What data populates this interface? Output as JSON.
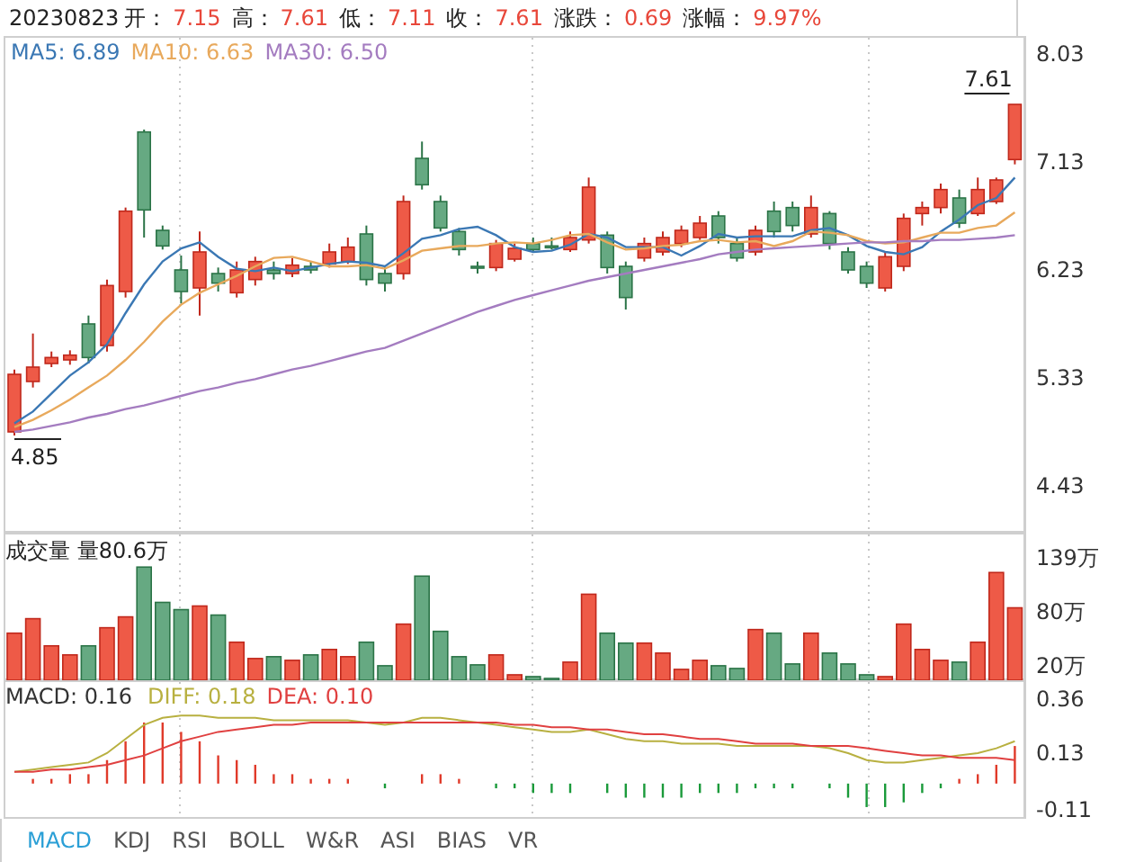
{
  "header": {
    "date": "20230823",
    "fields": [
      {
        "label": "开：",
        "value": "7.15"
      },
      {
        "label": "高：",
        "value": "7.61"
      },
      {
        "label": "低：",
        "value": "7.11"
      },
      {
        "label": "收：",
        "value": "7.61"
      },
      {
        "label": "涨跌：",
        "value": "0.69"
      },
      {
        "label": "涨幅：",
        "value": "9.97%"
      }
    ]
  },
  "price_panel": {
    "candles": {
      "chart_data": {
        "type": "candlestick",
        "categories": [
          null,
          null,
          null,
          null,
          null,
          null,
          null,
          null,
          null,
          null,
          null,
          null,
          null,
          null,
          null,
          null,
          null,
          null,
          null,
          null,
          null,
          null,
          null,
          null,
          null,
          null,
          null,
          null,
          null,
          null,
          null,
          null,
          null,
          null,
          null,
          null,
          null,
          null,
          null,
          null,
          null,
          null,
          null,
          null,
          null,
          null,
          null,
          null,
          null,
          null,
          null,
          null,
          null,
          null,
          null
        ],
        "ylim": [
          4.04,
          8.18
        ],
        "annotations": [
          {
            "text": "7.61"
          },
          {
            "text": "4.85"
          }
        ],
        "ohlc": [
          [
            4.88,
            5.4,
            4.85,
            5.36
          ],
          [
            5.3,
            5.7,
            5.25,
            5.42
          ],
          [
            5.45,
            5.55,
            5.42,
            5.5
          ],
          [
            5.48,
            5.56,
            5.44,
            5.52
          ],
          [
            5.78,
            5.85,
            5.45,
            5.5
          ],
          [
            5.6,
            6.15,
            5.55,
            6.1
          ],
          [
            6.05,
            6.75,
            6.0,
            6.72
          ],
          [
            7.38,
            7.4,
            6.5,
            6.73
          ],
          [
            6.56,
            6.6,
            6.4,
            6.43
          ],
          [
            6.23,
            6.35,
            5.95,
            6.05
          ],
          [
            6.08,
            6.55,
            5.85,
            6.38
          ],
          [
            6.2,
            6.25,
            6.05,
            6.12
          ],
          [
            6.04,
            6.3,
            6.0,
            6.23
          ],
          [
            6.15,
            6.34,
            6.1,
            6.3
          ],
          [
            6.23,
            6.3,
            6.15,
            6.2
          ],
          [
            6.2,
            6.33,
            6.17,
            6.27
          ],
          [
            6.26,
            6.3,
            6.2,
            6.23
          ],
          [
            6.28,
            6.45,
            6.25,
            6.38
          ],
          [
            6.3,
            6.5,
            6.28,
            6.42
          ],
          [
            6.53,
            6.6,
            6.1,
            6.15
          ],
          [
            6.2,
            6.25,
            6.05,
            6.12
          ],
          [
            6.2,
            6.85,
            6.15,
            6.8
          ],
          [
            7.16,
            7.3,
            6.9,
            6.94
          ],
          [
            6.8,
            6.85,
            6.55,
            6.58
          ],
          [
            6.55,
            6.58,
            6.35,
            6.4
          ],
          [
            6.26,
            6.3,
            6.2,
            6.25
          ],
          [
            6.25,
            6.48,
            6.22,
            6.45
          ],
          [
            6.32,
            6.45,
            6.3,
            6.41
          ],
          [
            6.45,
            6.5,
            6.38,
            6.4
          ],
          [
            6.43,
            6.5,
            6.4,
            6.42
          ],
          [
            6.4,
            6.55,
            6.38,
            6.5
          ],
          [
            6.48,
            7.0,
            6.45,
            6.92
          ],
          [
            6.52,
            6.55,
            6.2,
            6.25
          ],
          [
            6.26,
            6.3,
            5.9,
            6.0
          ],
          [
            6.33,
            6.5,
            6.3,
            6.45
          ],
          [
            6.38,
            6.55,
            6.35,
            6.5
          ],
          [
            6.45,
            6.6,
            6.42,
            6.56
          ],
          [
            6.5,
            6.68,
            6.48,
            6.62
          ],
          [
            6.68,
            6.72,
            6.45,
            6.5
          ],
          [
            6.45,
            6.5,
            6.3,
            6.33
          ],
          [
            6.38,
            6.6,
            6.35,
            6.56
          ],
          [
            6.72,
            6.8,
            6.5,
            6.55
          ],
          [
            6.75,
            6.8,
            6.55,
            6.6
          ],
          [
            6.53,
            6.85,
            6.5,
            6.75
          ],
          [
            6.7,
            6.72,
            6.4,
            6.45
          ],
          [
            6.38,
            6.42,
            6.2,
            6.23
          ],
          [
            6.26,
            6.3,
            6.08,
            6.12
          ],
          [
            6.08,
            6.38,
            6.05,
            6.34
          ],
          [
            6.26,
            6.7,
            6.22,
            6.66
          ],
          [
            6.7,
            6.8,
            6.6,
            6.75
          ],
          [
            6.75,
            6.95,
            6.7,
            6.9
          ],
          [
            6.83,
            6.9,
            6.58,
            6.62
          ],
          [
            6.7,
            7.0,
            6.68,
            6.9
          ],
          [
            6.8,
            7.0,
            6.78,
            6.98
          ],
          [
            7.15,
            7.61,
            7.11,
            7.61
          ]
        ]
      }
    },
    "chart_data": {
      "type": "line",
      "grid": "x",
      "categories": [
        null,
        null,
        null,
        null,
        null,
        null,
        null,
        null,
        null,
        null,
        null,
        null,
        null,
        null,
        null,
        null,
        null,
        null,
        null,
        null,
        null,
        null,
        null,
        null,
        null,
        null,
        null,
        null,
        null,
        null,
        null,
        null,
        null,
        null,
        null,
        null,
        null,
        null,
        null,
        null,
        null,
        null,
        null,
        null,
        null,
        null,
        null,
        null,
        null,
        null,
        null,
        null,
        null,
        null,
        null
      ],
      "yticks": [
        {
          "value": 8.03,
          "label": "8.03"
        },
        {
          "value": 7.13,
          "label": "7.13"
        },
        {
          "value": 6.23,
          "label": "6.23"
        },
        {
          "value": 5.33,
          "label": "5.33"
        },
        {
          "value": 4.43,
          "label": "4.43"
        }
      ],
      "ylim": [
        4.04,
        8.18
      ],
      "series": [
        {
          "name": "MA5: 6.89",
          "color": "#3b78b4",
          "values": [
            4.95,
            5.05,
            5.2,
            5.35,
            5.46,
            5.61,
            5.87,
            6.11,
            6.3,
            6.41,
            6.46,
            6.34,
            6.24,
            6.22,
            6.25,
            6.22,
            6.25,
            6.28,
            6.3,
            6.29,
            6.26,
            6.37,
            6.49,
            6.52,
            6.57,
            6.59,
            6.52,
            6.42,
            6.38,
            6.39,
            6.44,
            6.53,
            6.5,
            6.42,
            6.42,
            6.42,
            6.35,
            6.43,
            6.53,
            6.5,
            6.51,
            6.51,
            6.51,
            6.56,
            6.58,
            6.52,
            6.43,
            6.38,
            6.36,
            6.42,
            6.55,
            6.65,
            6.77,
            6.83,
            7.0
          ]
        },
        {
          "name": "MA10: 6.63",
          "color": "#e8a95c",
          "values": [
            4.92,
            4.98,
            5.06,
            5.15,
            5.25,
            5.35,
            5.48,
            5.63,
            5.8,
            5.94,
            6.04,
            6.11,
            6.18,
            6.26,
            6.33,
            6.34,
            6.3,
            6.26,
            6.26,
            6.27,
            6.24,
            6.31,
            6.39,
            6.41,
            6.43,
            6.43,
            6.45,
            6.46,
            6.45,
            6.48,
            6.52,
            6.53,
            6.46,
            6.4,
            6.41,
            6.43,
            6.44,
            6.47,
            6.48,
            6.46,
            6.47,
            6.43,
            6.47,
            6.55,
            6.54,
            6.52,
            6.47,
            6.45,
            6.46,
            6.5,
            6.54,
            6.54,
            6.58,
            6.6,
            6.71
          ]
        },
        {
          "name": "MA30: 6.50",
          "color": "#a47cc0",
          "values": [
            4.88,
            4.9,
            4.93,
            4.96,
            5.0,
            5.03,
            5.07,
            5.1,
            5.14,
            5.18,
            5.22,
            5.25,
            5.29,
            5.32,
            5.36,
            5.4,
            5.43,
            5.47,
            5.51,
            5.55,
            5.58,
            5.64,
            5.7,
            5.76,
            5.82,
            5.88,
            5.93,
            5.98,
            6.02,
            6.06,
            6.1,
            6.14,
            6.17,
            6.2,
            6.23,
            6.26,
            6.29,
            6.32,
            6.36,
            6.38,
            6.4,
            6.41,
            6.42,
            6.43,
            6.44,
            6.45,
            6.46,
            6.46,
            6.47,
            6.47,
            6.48,
            6.48,
            6.49,
            6.5,
            6.52
          ]
        }
      ]
    }
  },
  "volume_panel": {
    "title": "成交量 量80.6万",
    "chart_data": {
      "type": "bar",
      "grid": "x",
      "categories": [
        null,
        null,
        null,
        null,
        null,
        null,
        null,
        null,
        null,
        null,
        null,
        null,
        null,
        null,
        null,
        null,
        null,
        null,
        null,
        null,
        null,
        null,
        null,
        null,
        null,
        null,
        null,
        null,
        null,
        null,
        null,
        null,
        null,
        null,
        null,
        null,
        null,
        null,
        null,
        null,
        null,
        null,
        null,
        null,
        null,
        null,
        null,
        null,
        null,
        null,
        null,
        null,
        null,
        null,
        null
      ],
      "ylim": [
        4,
        167
      ],
      "yticks": [
        {
          "value": 139,
          "label": "139万"
        },
        {
          "value": 80,
          "label": "80万"
        },
        {
          "value": 20,
          "label": "20万"
        }
      ],
      "values": [
        56,
        72,
        42,
        32,
        42,
        62,
        74,
        129,
        90,
        82,
        86,
        76,
        46,
        28,
        30,
        26,
        32,
        38,
        30,
        46,
        20,
        66,
        119,
        58,
        30,
        21,
        32,
        10,
        8,
        6,
        24,
        99,
        56,
        45,
        45,
        34,
        16,
        26,
        20,
        17,
        60,
        56,
        22,
        56,
        34,
        22,
        10,
        8,
        66,
        38,
        26,
        24,
        46,
        123,
        84
      ]
    }
  },
  "macd_panel": {
    "histogram": {
      "chart_data": {
        "type": "bar",
        "title": "MACD: 0.16",
        "categories": [
          null,
          null,
          null,
          null,
          null,
          null,
          null,
          null,
          null,
          null,
          null,
          null,
          null,
          null,
          null,
          null,
          null,
          null,
          null,
          null,
          null,
          null,
          null,
          null,
          null,
          null,
          null,
          null,
          null,
          null,
          null,
          null,
          null,
          null,
          null,
          null,
          null,
          null,
          null,
          null,
          null,
          null,
          null,
          null,
          null,
          null,
          null,
          null,
          null,
          null,
          null,
          null,
          null,
          null,
          null
        ],
        "ylim": [
          -0.15,
          0.44
        ],
        "values": [
          0,
          0.02,
          0.02,
          0.04,
          0.04,
          0.1,
          0.18,
          0.26,
          0.26,
          0.22,
          0.18,
          0.12,
          0.1,
          0.08,
          0.04,
          0.04,
          0.02,
          0.02,
          0.02,
          0,
          -0.02,
          0,
          0.04,
          0.04,
          0.02,
          0,
          -0.02,
          -0.02,
          -0.04,
          -0.04,
          -0.04,
          0,
          -0.04,
          -0.06,
          -0.06,
          -0.06,
          -0.06,
          -0.04,
          -0.04,
          -0.04,
          -0.02,
          -0.02,
          -0.02,
          0,
          -0.02,
          -0.06,
          -0.1,
          -0.1,
          -0.08,
          -0.04,
          -0.02,
          0.02,
          0.04,
          0.08,
          0.16
        ]
      }
    },
    "chart_data": {
      "type": "line",
      "grid": "x",
      "categories": [
        null,
        null,
        null,
        null,
        null,
        null,
        null,
        null,
        null,
        null,
        null,
        null,
        null,
        null,
        null,
        null,
        null,
        null,
        null,
        null,
        null,
        null,
        null,
        null,
        null,
        null,
        null,
        null,
        null,
        null,
        null,
        null,
        null,
        null,
        null,
        null,
        null,
        null,
        null,
        null,
        null,
        null,
        null,
        null,
        null,
        null,
        null,
        null,
        null,
        null,
        null,
        null,
        null,
        null,
        null
      ],
      "ylim": [
        -0.15,
        0.44
      ],
      "yticks": [
        {
          "value": 0.36,
          "label": "0.36"
        },
        {
          "value": 0.13,
          "label": "0.13"
        },
        {
          "value": -0.11,
          "label": "-0.11"
        }
      ],
      "series": [
        {
          "name": "DIFF: 0.18",
          "color": "#b8b040",
          "values": [
            0.05,
            0.06,
            0.07,
            0.08,
            0.09,
            0.13,
            0.19,
            0.25,
            0.28,
            0.29,
            0.29,
            0.28,
            0.28,
            0.28,
            0.27,
            0.27,
            0.27,
            0.27,
            0.27,
            0.26,
            0.25,
            0.26,
            0.28,
            0.28,
            0.27,
            0.26,
            0.25,
            0.24,
            0.23,
            0.22,
            0.22,
            0.23,
            0.21,
            0.19,
            0.18,
            0.18,
            0.17,
            0.17,
            0.17,
            0.16,
            0.16,
            0.16,
            0.16,
            0.16,
            0.15,
            0.13,
            0.1,
            0.09,
            0.09,
            0.1,
            0.11,
            0.12,
            0.13,
            0.15,
            0.18
          ]
        },
        {
          "name": "DEA: 0.10",
          "color": "#e04040",
          "values": [
            0.05,
            0.05,
            0.06,
            0.06,
            0.07,
            0.08,
            0.1,
            0.12,
            0.15,
            0.18,
            0.2,
            0.22,
            0.23,
            0.24,
            0.25,
            0.25,
            0.26,
            0.26,
            0.26,
            0.26,
            0.26,
            0.26,
            0.26,
            0.26,
            0.26,
            0.26,
            0.26,
            0.25,
            0.25,
            0.24,
            0.24,
            0.23,
            0.23,
            0.22,
            0.21,
            0.21,
            0.2,
            0.19,
            0.19,
            0.18,
            0.17,
            0.17,
            0.17,
            0.16,
            0.16,
            0.16,
            0.15,
            0.14,
            0.13,
            0.12,
            0.12,
            0.11,
            0.11,
            0.11,
            0.1
          ]
        }
      ]
    }
  },
  "tabs": [
    {
      "label": "MACD",
      "selected": true
    },
    {
      "label": "KDJ",
      "selected": false
    },
    {
      "label": "RSI",
      "selected": false
    },
    {
      "label": "BOLL",
      "selected": false
    },
    {
      "label": "W&R",
      "selected": false
    },
    {
      "label": "ASI",
      "selected": false
    },
    {
      "label": "BIAS",
      "selected": false
    },
    {
      "label": "VR",
      "selected": false
    }
  ]
}
